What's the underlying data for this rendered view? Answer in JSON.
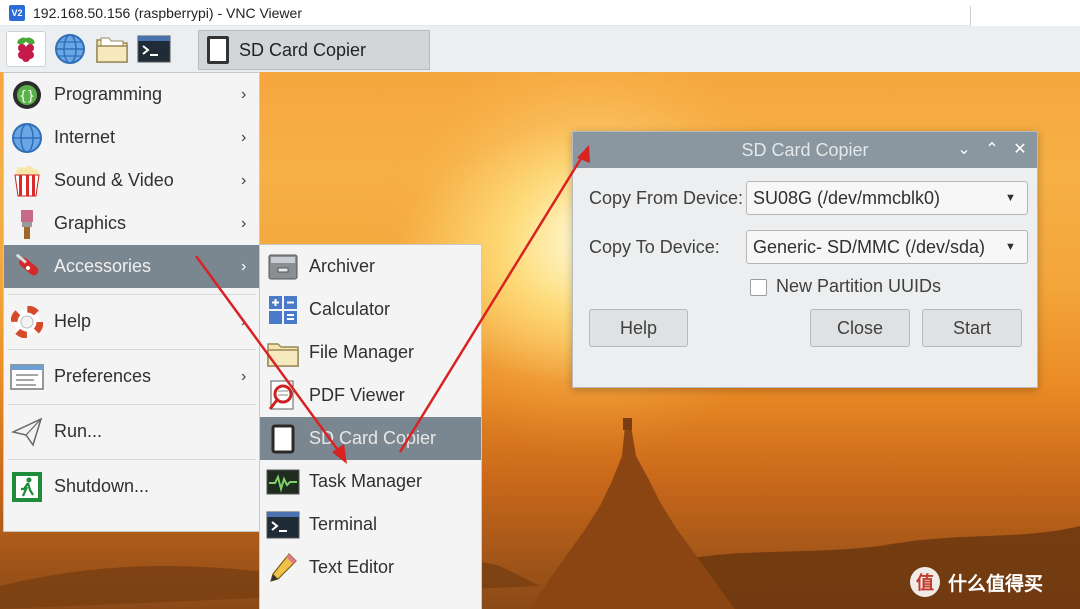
{
  "vnc": {
    "logo": "V2",
    "title": "192.168.50.156 (raspberrypi) - VNC Viewer"
  },
  "taskbar": {
    "icons": [
      "raspberry-icon",
      "globe-icon",
      "folder-icon",
      "terminal-icon"
    ],
    "task_label": "SD Card Copier"
  },
  "menu": {
    "items": [
      {
        "label": "Programming",
        "icon": "programming-icon",
        "submenu": true
      },
      {
        "label": "Internet",
        "icon": "globe-icon",
        "submenu": true
      },
      {
        "label": "Sound & Video",
        "icon": "popcorn-icon",
        "submenu": true
      },
      {
        "label": "Graphics",
        "icon": "paintbrush-icon",
        "submenu": true
      },
      {
        "label": "Accessories",
        "icon": "pocketknife-icon",
        "submenu": true,
        "active": true
      },
      {
        "label": "Help",
        "icon": "lifebuoy-icon",
        "submenu": true
      },
      {
        "label": "Preferences",
        "icon": "preferences-icon",
        "submenu": true
      },
      {
        "label": "Run...",
        "icon": "paper-plane-icon",
        "submenu": false
      },
      {
        "label": "Shutdown...",
        "icon": "exit-icon",
        "submenu": false
      }
    ],
    "arrow": "›"
  },
  "submenu": {
    "items": [
      {
        "label": "Archiver",
        "icon": "archive-icon"
      },
      {
        "label": "Calculator",
        "icon": "calculator-icon"
      },
      {
        "label": "File Manager",
        "icon": "folder-icon"
      },
      {
        "label": "PDF Viewer",
        "icon": "pdf-icon"
      },
      {
        "label": "SD Card Copier",
        "icon": "sd-card-icon",
        "active": true
      },
      {
        "label": "Task Manager",
        "icon": "task-manager-icon"
      },
      {
        "label": "Terminal",
        "icon": "terminal-icon"
      },
      {
        "label": "Text Editor",
        "icon": "pencil-icon"
      }
    ]
  },
  "dialog": {
    "title": "SD Card Copier",
    "copy_from_label": "Copy From Device:",
    "copy_from_value": "SU08G  (/dev/mmcblk0)",
    "copy_to_label": "Copy To Device:",
    "copy_to_value": "Generic- SD/MMC  (/dev/sda)",
    "new_uuids_label": "New Partition UUIDs",
    "new_uuids_checked": false,
    "help_button": "Help",
    "close_button": "Close",
    "start_button": "Start",
    "ctrl_minimize": "⌄",
    "ctrl_maximize": "⌃",
    "ctrl_close": "✕"
  },
  "watermark": {
    "logo": "值",
    "text": "什么值得买"
  },
  "colors": {
    "arrow": "#d92323",
    "menu_active": "#7b8790",
    "dialog_title_bg": "#8a96a0"
  }
}
